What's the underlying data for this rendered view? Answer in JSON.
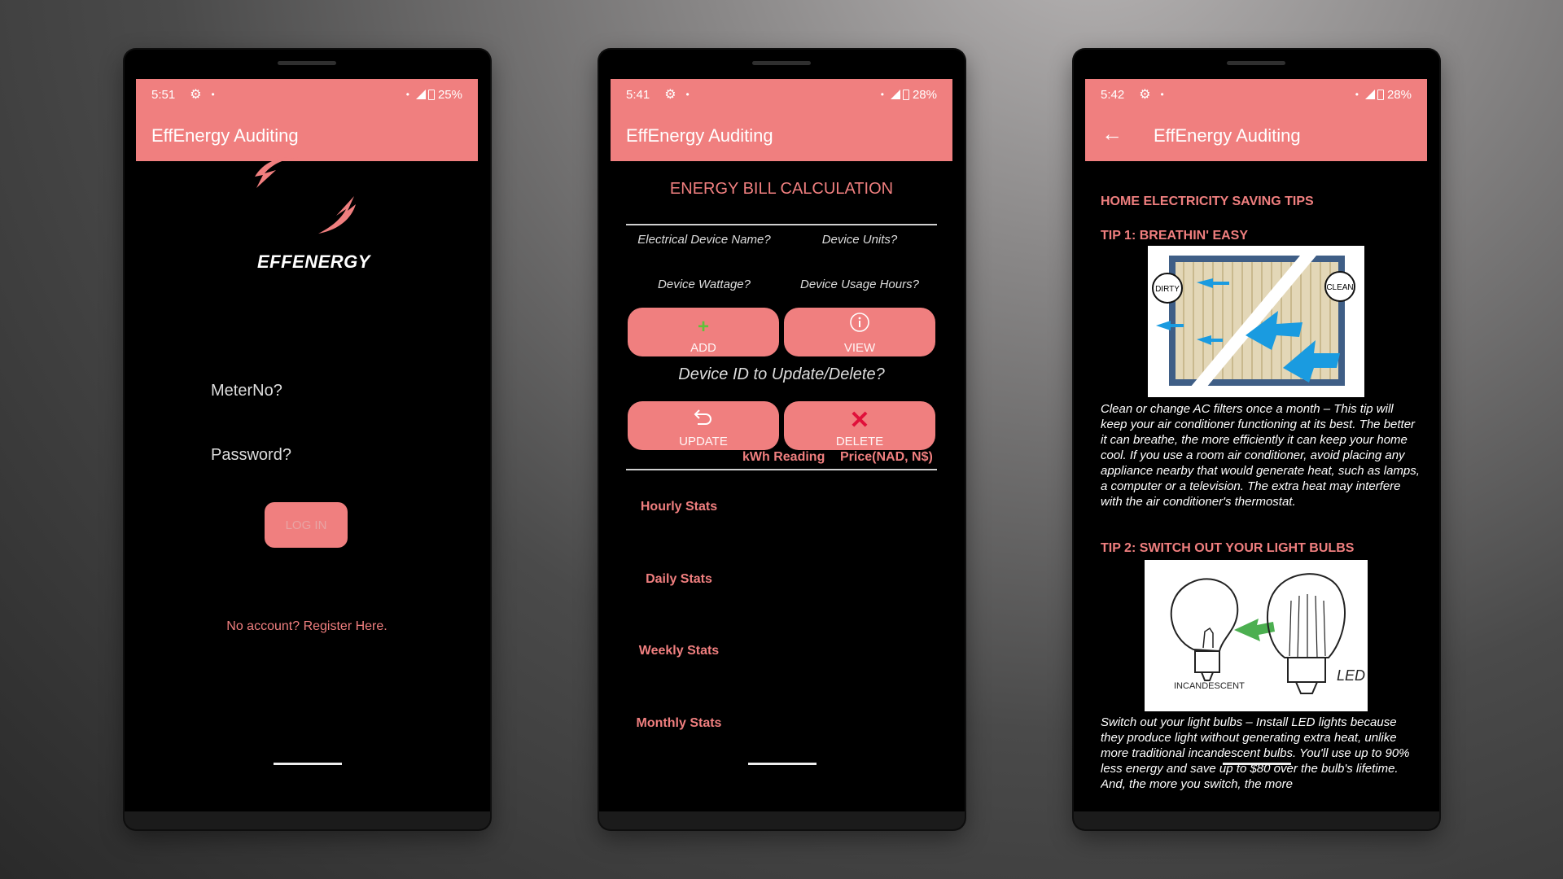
{
  "app": {
    "title": "EffEnergy Auditing",
    "accent": "#f07f7f"
  },
  "screen1": {
    "status": {
      "time": "5:51",
      "battery": "25%"
    },
    "logo_text": "EFFENERGY",
    "meter_placeholder": "MeterNo?",
    "password_placeholder": "Password?",
    "login_label": "LOG IN",
    "register_link": "No account? Register Here."
  },
  "screen2": {
    "status": {
      "time": "5:41",
      "battery": "28%"
    },
    "section_title": "ENERGY BILL CALCULATION",
    "device_name_placeholder": "Electrical Device Name?",
    "device_units_placeholder": "Device Units?",
    "device_wattage_placeholder": "Device Wattage?",
    "device_hours_placeholder": "Device Usage Hours?",
    "add_label": "ADD",
    "view_label": "VIEW",
    "device_id_placeholder": "Device ID to Update/Delete?",
    "update_label": "UPDATE",
    "delete_label": "DELETE",
    "col_kwh": "kWh Reading",
    "col_price": "Price(NAD, N$)",
    "stats": [
      "Hourly Stats",
      "Daily Stats",
      "Weekly Stats",
      "Monthly Stats"
    ]
  },
  "screen3": {
    "status": {
      "time": "5:42",
      "battery": "28%"
    },
    "heading": "HOME ELECTRICITY SAVING TIPS",
    "tip1_title": "TIP 1: BREATHIN' EASY",
    "tip1_img_dirty": "DIRTY",
    "tip1_img_clean": "CLEAN",
    "tip1_text": "Clean or change AC filters once a month – This tip will keep your air conditioner functioning at its best. The better it can breathe, the more efficiently it can keep your home cool. If you use a room air conditioner, avoid placing any appliance nearby that would generate heat, such as lamps, a computer or a television. The extra heat may interfere with the air conditioner's thermostat.",
    "tip2_title": "TIP 2: SWITCH OUT YOUR LIGHT BULBS",
    "tip2_img_incandescent": "INCANDESCENT",
    "tip2_img_led": "LED",
    "tip2_text": "Switch out your light bulbs – Install LED lights because they produce light without generating extra heat, unlike more traditional incandescent bulbs. You'll use up to 90% less energy and save up to $80 over the bulb's lifetime. And, the more you switch, the more"
  }
}
